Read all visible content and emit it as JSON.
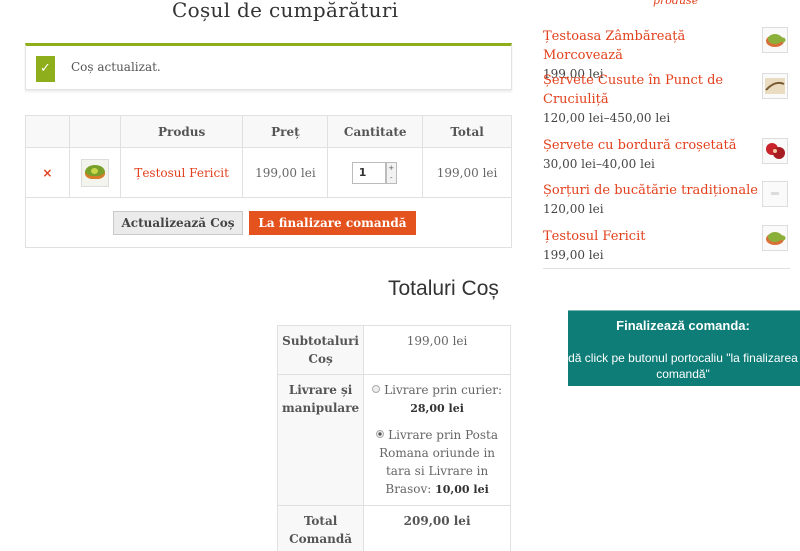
{
  "page": {
    "title": "Coșul de cumpărături"
  },
  "notice": {
    "message": "Coș actualizat.",
    "icon": "checkmark-icon",
    "accent": "#8fae1b"
  },
  "cart": {
    "headers": [
      "",
      "",
      "Produs",
      "Preț",
      "Cantitate",
      "Total"
    ],
    "items": [
      {
        "remove_label": "×",
        "thumbnail_icon": "turtle-image",
        "name": "Țestosul Fericit",
        "price": "199,00 lei",
        "quantity": "1",
        "total": "199,00 lei"
      }
    ],
    "spinner": {
      "up": "+",
      "down": "-"
    },
    "update_button": "Actualizează Coș",
    "checkout_button": "La finalizare comandă",
    "checkout_color": "#e4521e"
  },
  "sidebar": {
    "heading": "produse",
    "products": [
      {
        "name": "Țestoasa Zâmbăreață Morcovează",
        "price": "199,00 lei",
        "icon": "turtle-image"
      },
      {
        "name": "Șervete Cusute în Punct de Cruciuliță",
        "price": "120,00 lei–450,00 lei",
        "icon": "napkin-image"
      },
      {
        "name": "Șervete cu bordură croșetată",
        "price": "30,00 lei–40,00 lei",
        "icon": "crochet-napkin-image"
      },
      {
        "name": "Șorțuri de bucătărie tradiționale",
        "price": "120,00 lei",
        "icon": "apron-image"
      },
      {
        "name": "Țestosul Fericit",
        "price": "199,00 lei",
        "icon": "turtle-image"
      }
    ]
  },
  "totals": {
    "title": "Totaluri Coș",
    "subtotal_label": "Subtotaluri Coș",
    "subtotal_value": "199,00 lei",
    "shipping_label": "Livrare și manipulare",
    "shipping_options": [
      {
        "label": "Livrare prin curier:",
        "amount": "28,00 lei",
        "selected": false
      },
      {
        "label": "Livrare prin Posta Romana oriunde in tara si Livrare in Brasov:",
        "amount": "10,00 lei",
        "selected": true
      }
    ],
    "total_label": "Total Comandă",
    "total_value": "209,00 lei"
  },
  "callout": {
    "title": "Finalizează comanda:",
    "body": "dă click pe butonul portocaliu \"la finalizarea comandă\"",
    "color": "#0e7c77"
  }
}
